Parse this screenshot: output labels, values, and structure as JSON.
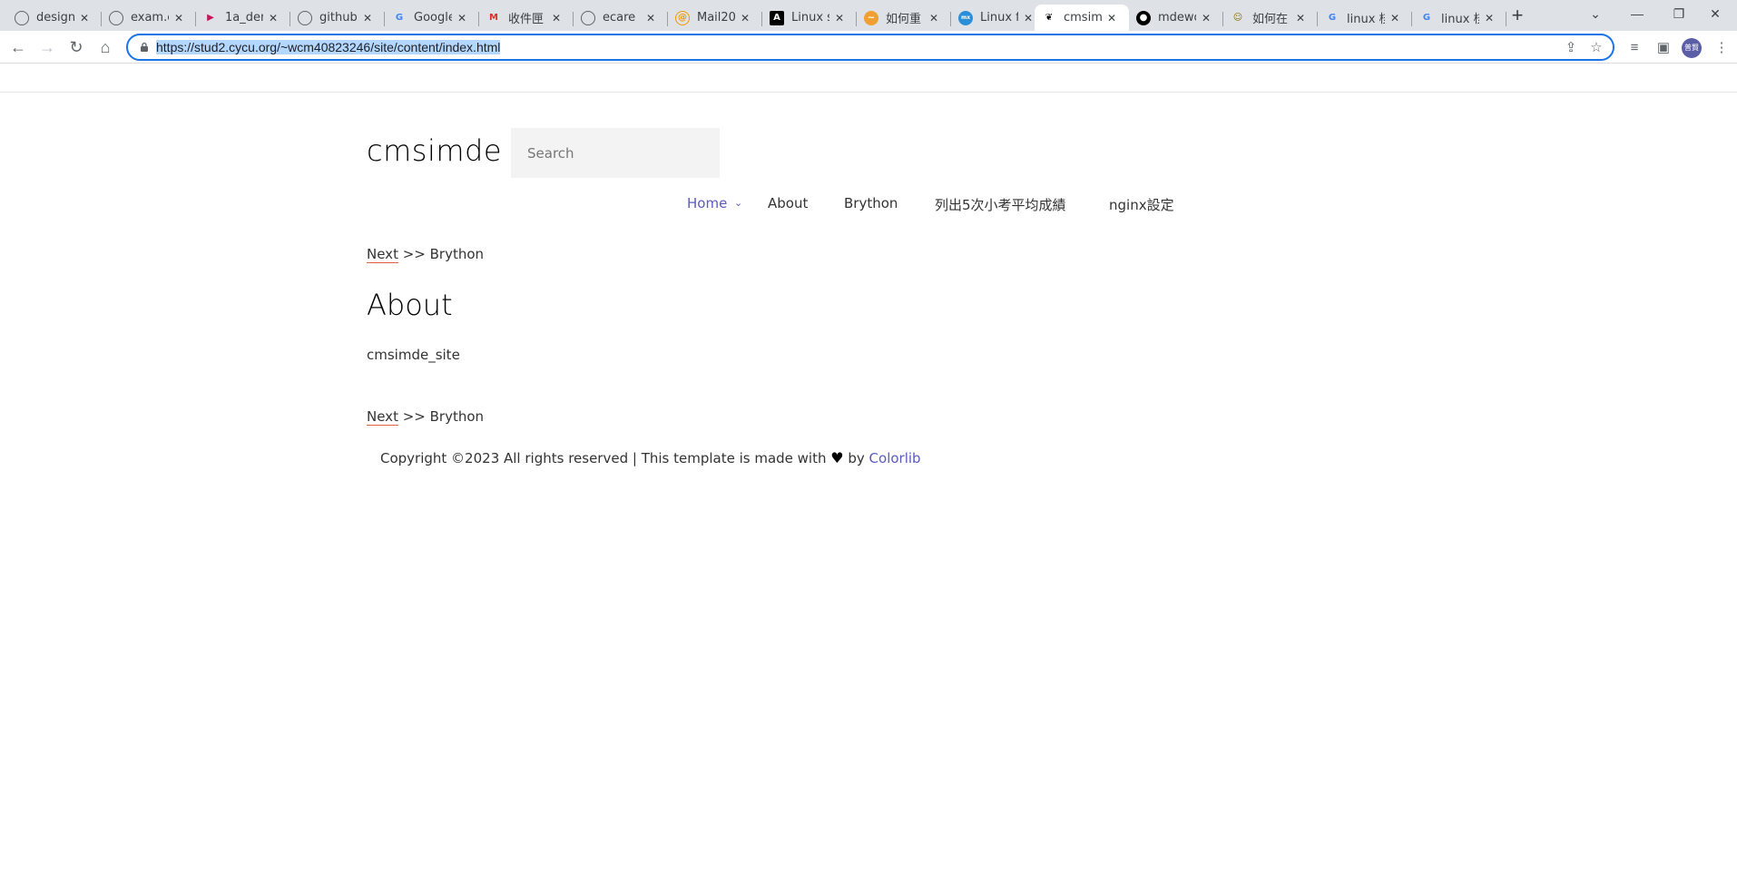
{
  "browser": {
    "tabs": [
      {
        "label": "design",
        "icon": "globe-icon"
      },
      {
        "label": "exam.c",
        "icon": "globe-icon"
      },
      {
        "label": "1a_dem",
        "icon": "play-icon"
      },
      {
        "label": "github",
        "icon": "globe-icon"
      },
      {
        "label": "Google",
        "icon": "google-icon"
      },
      {
        "label": "收件匣",
        "icon": "gmail-icon"
      },
      {
        "label": "ecare",
        "icon": "globe-icon"
      },
      {
        "label": "Mail20",
        "icon": "mail-icon"
      },
      {
        "label": "Linux s",
        "icon": "a-logo-icon"
      },
      {
        "label": "如何重",
        "icon": "bird-icon"
      },
      {
        "label": "Linux f",
        "icon": "site-icon"
      },
      {
        "label": "cmsim",
        "icon": "cmsim-icon",
        "active": true
      },
      {
        "label": "mdewo",
        "icon": "github-icon"
      },
      {
        "label": "如何在",
        "icon": "figure-icon"
      },
      {
        "label": "linux 核",
        "icon": "google-icon"
      },
      {
        "label": "linux 核",
        "icon": "google-icon"
      }
    ],
    "url_prefix": "https://",
    "url_rest": "stud2.cycu.org/~wcm40823246/site/content/index.html",
    "avatar_text": "普賢"
  },
  "site": {
    "title": "cmsimde",
    "search_placeholder": "Search",
    "nav": {
      "home": "Home",
      "about": "About",
      "brython": "Brython",
      "grades": "列出5次小考平均成績",
      "nginx": "nginx設定"
    },
    "pager": {
      "next": "Next",
      "rest": " >> Brython"
    },
    "heading": "About",
    "body": "cmsimde_site",
    "footer": {
      "prefix": "Copyright ©2023 All rights reserved | This template is made with ",
      "heart": "♥",
      "by": " by ",
      "link": "Colorlib"
    }
  },
  "colors": {
    "accent": "#5a5bbf",
    "focus": "#1a73e8"
  }
}
